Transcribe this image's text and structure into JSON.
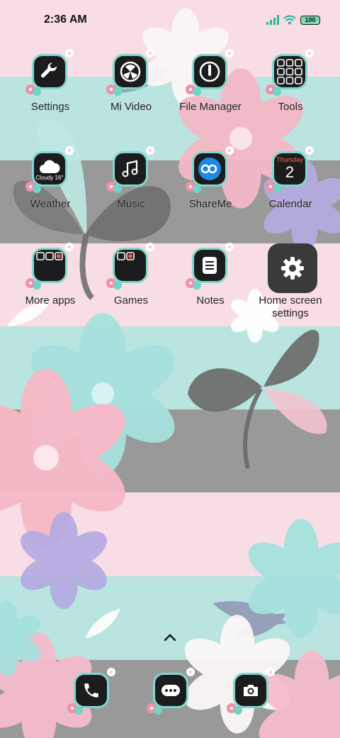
{
  "status_bar": {
    "time": "2:36 AM",
    "battery": "100",
    "icons": [
      "signal-icon",
      "wifi-icon",
      "battery-icon"
    ]
  },
  "weather_widget": {
    "text": "Cloudy 16°"
  },
  "calendar_widget": {
    "weekday": "Thursday",
    "day": "2"
  },
  "apps": [
    {
      "label": "Settings",
      "icon": "wrench-icon"
    },
    {
      "label": "Mi Video",
      "icon": "video-reel-icon"
    },
    {
      "label": "File Manager",
      "icon": "file-manager-icon"
    },
    {
      "label": "Tools",
      "icon": "tools-folder-icon"
    },
    {
      "label": "Weather",
      "icon": "weather-icon"
    },
    {
      "label": "Music",
      "icon": "music-note-icon"
    },
    {
      "label": "ShareMe",
      "icon": "shareme-icon"
    },
    {
      "label": "Calendar",
      "icon": "calendar-icon"
    },
    {
      "label": "More apps",
      "icon": "folder-icon"
    },
    {
      "label": "Games",
      "icon": "games-folder-icon"
    },
    {
      "label": "Notes",
      "icon": "notes-icon"
    },
    {
      "label": "Home screen\nsettings",
      "icon": "gear-icon"
    }
  ],
  "dock": [
    {
      "name": "phone",
      "icon": "phone-icon"
    },
    {
      "name": "messages",
      "icon": "messages-icon"
    },
    {
      "name": "camera",
      "icon": "camera-icon"
    }
  ],
  "colors": {
    "accent_teal": "#7fd8cf",
    "tile": "#1c1c1c",
    "pink": "#f9dde4",
    "mint": "#b9e4df",
    "gray": "#999999"
  }
}
